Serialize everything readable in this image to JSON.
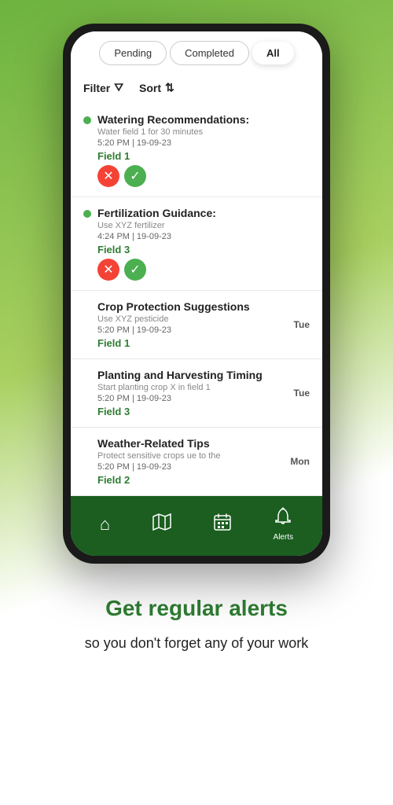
{
  "tabs": {
    "pending": "Pending",
    "completed": "Completed",
    "all": "All"
  },
  "filter_label": "Filter",
  "sort_label": "Sort",
  "tasks": [
    {
      "id": 1,
      "title": "Watering Recommendations:",
      "subtitle": "Water field 1 for 30 minutes",
      "time": "5:20 PM | 19-09-23",
      "field": "Field 1",
      "has_dot": true,
      "has_actions": true,
      "day": ""
    },
    {
      "id": 2,
      "title": "Fertilization Guidance:",
      "subtitle": "Use XYZ fertilizer",
      "time": "4:24 PM | 19-09-23",
      "field": "Field 3",
      "has_dot": true,
      "has_actions": true,
      "day": ""
    },
    {
      "id": 3,
      "title": "Crop Protection Suggestions",
      "subtitle": "Use XYZ pesticide",
      "time": "5:20 PM | 19-09-23",
      "field": "Field 1",
      "has_dot": false,
      "has_actions": false,
      "day": "Tue"
    },
    {
      "id": 4,
      "title": "Planting and Harvesting Timing",
      "subtitle": "Start planting crop X in field 1",
      "time": "5:20 PM | 19-09-23",
      "field": "Field 3",
      "has_dot": false,
      "has_actions": false,
      "day": "Tue"
    },
    {
      "id": 5,
      "title": "Weather-Related Tips",
      "subtitle": "Protect sensitive crops ue to the",
      "time": "5:20 PM | 19-09-23",
      "field": "Field 2",
      "has_dot": false,
      "has_actions": false,
      "day": "Mon"
    }
  ],
  "nav": {
    "items": [
      {
        "label": "",
        "icon": "home"
      },
      {
        "label": "",
        "icon": "map"
      },
      {
        "label": "",
        "icon": "calendar"
      },
      {
        "label": "Alerts",
        "icon": "bell"
      }
    ]
  },
  "promo": {
    "title": "Get regular alerts",
    "subtitle": "so you don't forget any of your work"
  }
}
